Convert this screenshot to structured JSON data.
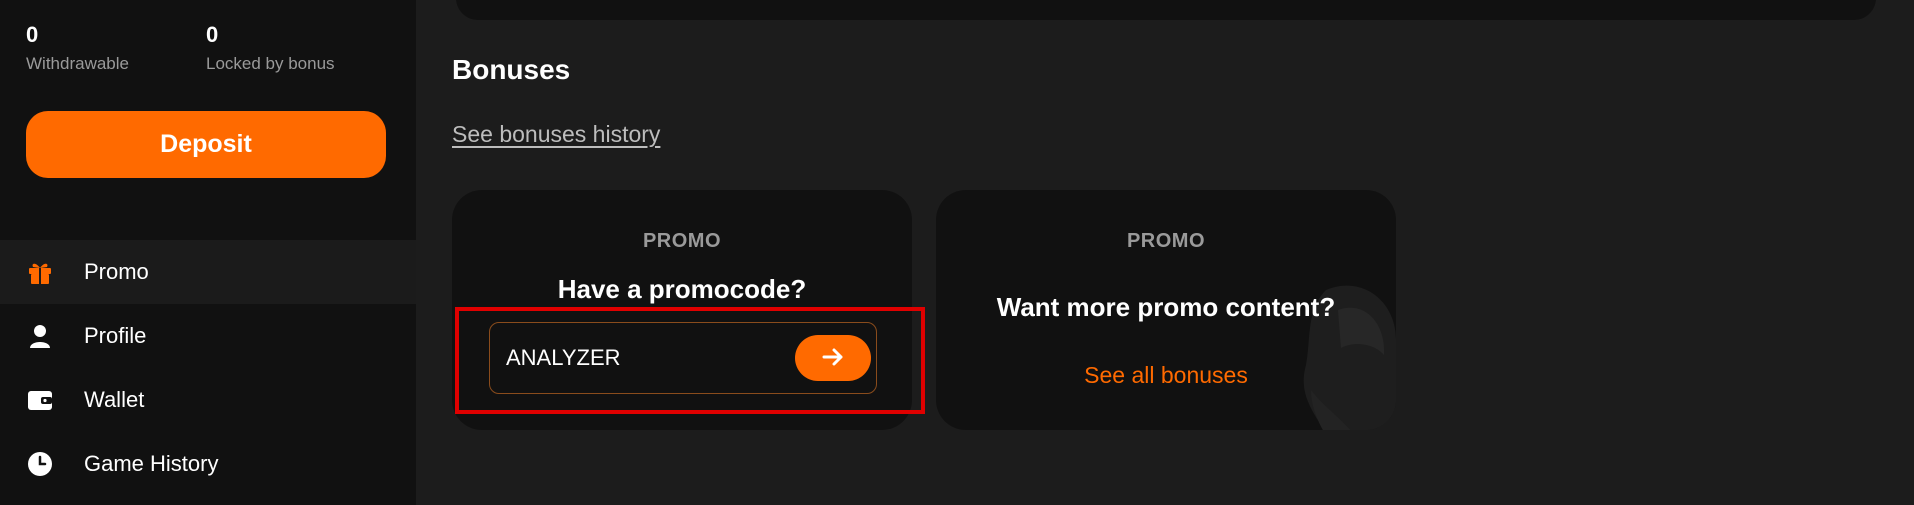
{
  "balances": {
    "withdrawable": {
      "value": "0",
      "label": "Withdrawable"
    },
    "locked": {
      "value": "0",
      "label": "Locked by bonus"
    }
  },
  "deposit_label": "Deposit",
  "nav": {
    "items": [
      {
        "label": "Promo",
        "icon": "gift-icon",
        "active": true
      },
      {
        "label": "Profile",
        "icon": "user-icon",
        "active": false
      },
      {
        "label": "Wallet",
        "icon": "wallet-icon",
        "active": false
      },
      {
        "label": "Game History",
        "icon": "clock-icon",
        "active": false
      }
    ]
  },
  "bonuses": {
    "title": "Bonuses",
    "history_link": "See bonuses history",
    "promocode_card": {
      "tag": "PROMO",
      "heading": "Have a promocode?",
      "input_value": "ANALYZER",
      "submit_icon": "arrow-right-icon"
    },
    "more_card": {
      "tag": "PROMO",
      "heading": "Want more promo content?",
      "link": "See all bonuses"
    }
  },
  "colors": {
    "accent": "#ff6a00",
    "sidebar_bg": "#111111",
    "page_bg": "#1c1c1c",
    "card_bg": "#111111",
    "highlight": "#e00000"
  }
}
